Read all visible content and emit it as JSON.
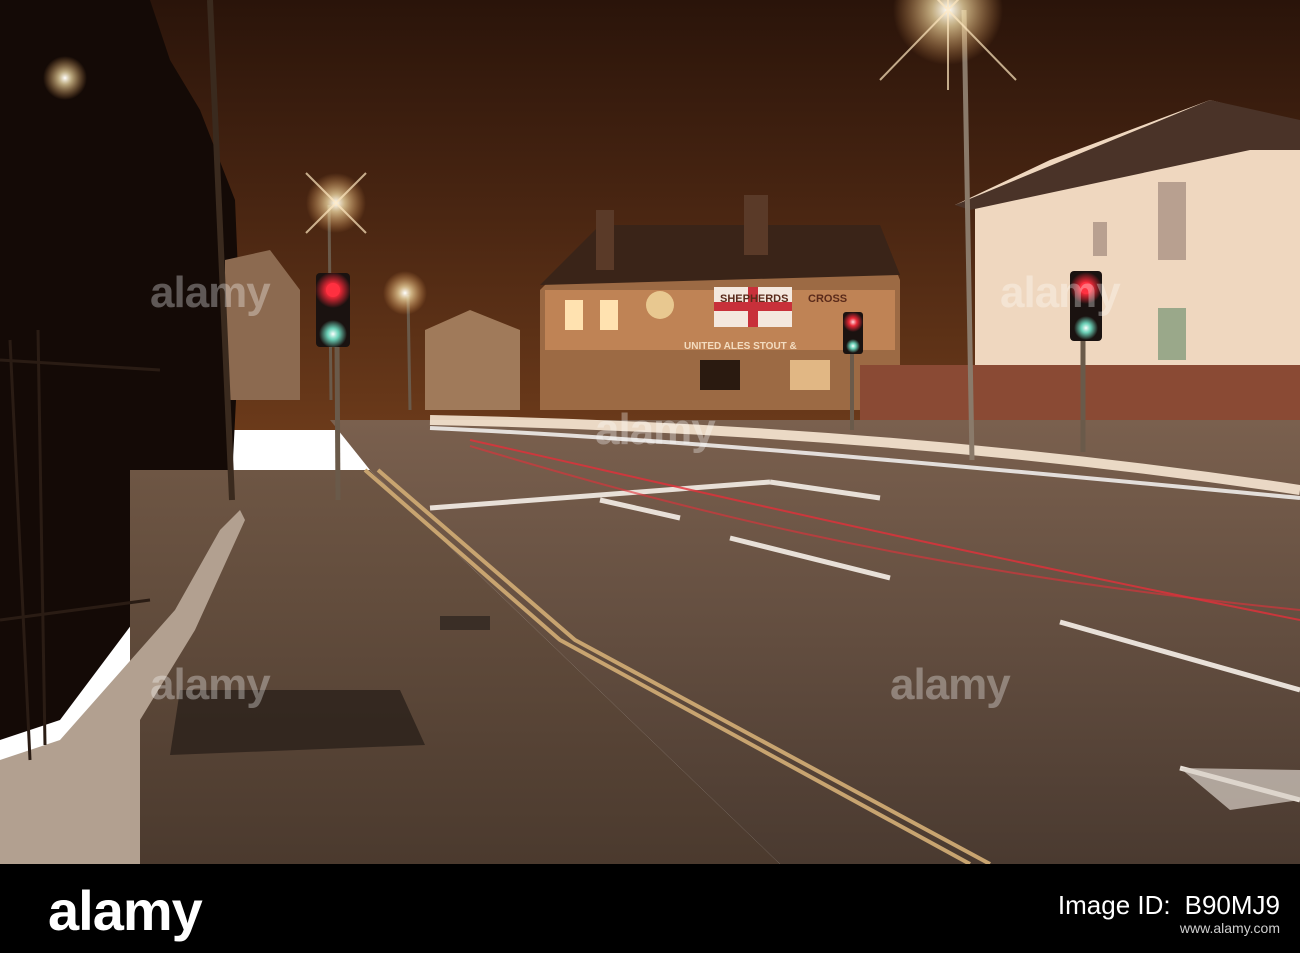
{
  "scene": {
    "description_free": true,
    "pub_sign_left": "SHEPHERDS",
    "pub_sign_right": "CROSS",
    "pub_fascia": "UNITED ALES STOUT &",
    "colors": {
      "sky": "#3a1e10",
      "road": "#5e4a3c",
      "light_trail_white": "#ffeeda",
      "light_trail_red": "#e3303a",
      "traffic_red": "#ff2a3a",
      "traffic_green": "#7fffe0"
    }
  },
  "watermark": {
    "text": "alamy"
  },
  "footer": {
    "logo": "alamy",
    "image_id_label": "Image ID:",
    "image_id": "B90MJ9",
    "url": "www.alamy.com"
  }
}
